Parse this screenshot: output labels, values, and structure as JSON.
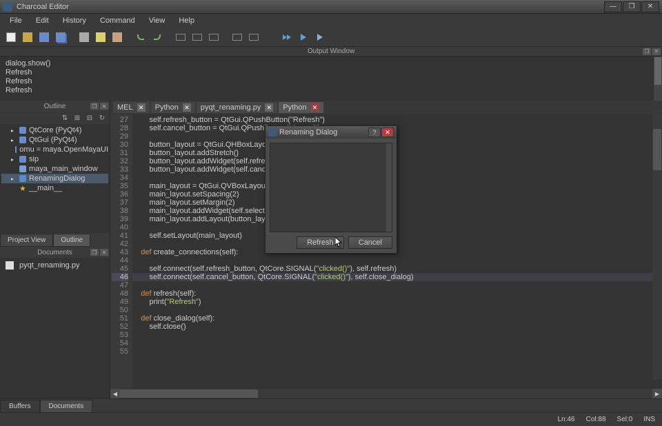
{
  "app": {
    "title": "Charcoal Editor"
  },
  "window_buttons": {
    "min": "—",
    "max": "❐",
    "close": "✕"
  },
  "menu": [
    "File",
    "Edit",
    "History",
    "Command",
    "View",
    "Help"
  ],
  "output": {
    "title": "Output Window",
    "lines": [
      "  dialog.show()",
      "Refresh",
      "Refresh",
      "Refresh"
    ]
  },
  "outline": {
    "title": "Outline",
    "items": [
      {
        "label": "QtCore (PyQt4)",
        "icon": "pkg",
        "depth": 1,
        "caret": "▸"
      },
      {
        "label": "QtGui (PyQt4)",
        "icon": "pkg",
        "depth": 1,
        "caret": "▸"
      },
      {
        "label": "omu = maya.OpenMayaUI",
        "icon": "pkg",
        "depth": 1,
        "caret": ""
      },
      {
        "label": "sip",
        "icon": "pkg",
        "depth": 1,
        "caret": "▸"
      },
      {
        "label": "maya_main_window",
        "icon": "m",
        "depth": 1,
        "caret": ""
      },
      {
        "label": "RenamingDialog",
        "icon": "c",
        "depth": 1,
        "caret": "▸",
        "sel": true
      },
      {
        "label": "__main__",
        "icon": "star",
        "depth": 1,
        "caret": ""
      }
    ]
  },
  "project_tabs": {
    "view": "Project View",
    "outline": "Outline"
  },
  "documents": {
    "title": "Documents",
    "items": [
      {
        "label": "pyqt_renaming.py"
      }
    ]
  },
  "bottom_tabs": {
    "buffers": "Buffers",
    "documents": "Documents"
  },
  "editor_tabs": [
    {
      "label": "MEL",
      "active": false
    },
    {
      "label": "Python",
      "active": false
    },
    {
      "label": "pyqt_renaming.py",
      "active": false
    },
    {
      "label": "Python",
      "active": true
    }
  ],
  "gutter": [
    "27",
    "28",
    "29",
    "30",
    "31",
    "32",
    "33",
    "34",
    "35",
    "36",
    "37",
    "38",
    "39",
    "40",
    "41",
    "42",
    "43",
    "44",
    "45",
    "46",
    "47",
    "48",
    "49",
    "50",
    "51",
    "52",
    "53",
    "54",
    "55"
  ],
  "code": {
    "l27": "        self.refresh_button = QtGui.QPushButton(\"Refresh\")",
    "l28": "        self.cancel_button = QtGui.QPushButton(\"Cancel\")",
    "l29": "",
    "l30": "        button_layout = QtGui.QHBoxLayout()",
    "l31": "        button_layout.addStretch()",
    "l32": "        button_layout.addWidget(self.refresh_button)",
    "l33": "        button_layout.addWidget(self.cancel_button)",
    "l34": "",
    "l35": "        main_layout = QtGui.QVBoxLayout()",
    "l36": "        main_layout.setSpacing(2)",
    "l37": "        main_layout.setMargin(2)",
    "l38": "        main_layout.addWidget(self.selection_list)",
    "l39": "        main_layout.addLayout(button_layout)",
    "l40": "",
    "l41": "        self.setLayout(main_layout)",
    "l42": "",
    "l43a": "    def",
    "l43b": " create_connections(self):",
    "l44": "",
    "l45a": "        self.connect(self.refresh_button, QtCore.SIGNAL(",
    "l45s": "\"clicked()\"",
    "l45b": "), self.refresh)",
    "l46a": "        self.connect(self.cancel_button, QtCore.SIGNAL(",
    "l46s": "\"clicked()\"",
    "l46b": "), self.close_dialog)",
    "l47": "",
    "l48a": "    def",
    "l48b": " refresh(self):",
    "l49a": "        print(",
    "l49s": "\"Refresh\"",
    "l49b": ")",
    "l50": "",
    "l51a": "    def",
    "l51b": " close_dialog(self):",
    "l52": "        self.close()",
    "l53": "",
    "l54": "",
    "l55": ""
  },
  "status": {
    "line": "Ln:46",
    "col": "Col:88",
    "sel": "Sel:0",
    "mode": "INS"
  },
  "dialog": {
    "title": "Renaming Dialog",
    "help": "?",
    "close": "✕",
    "refresh": "Refresh",
    "cancel": "Cancel"
  }
}
